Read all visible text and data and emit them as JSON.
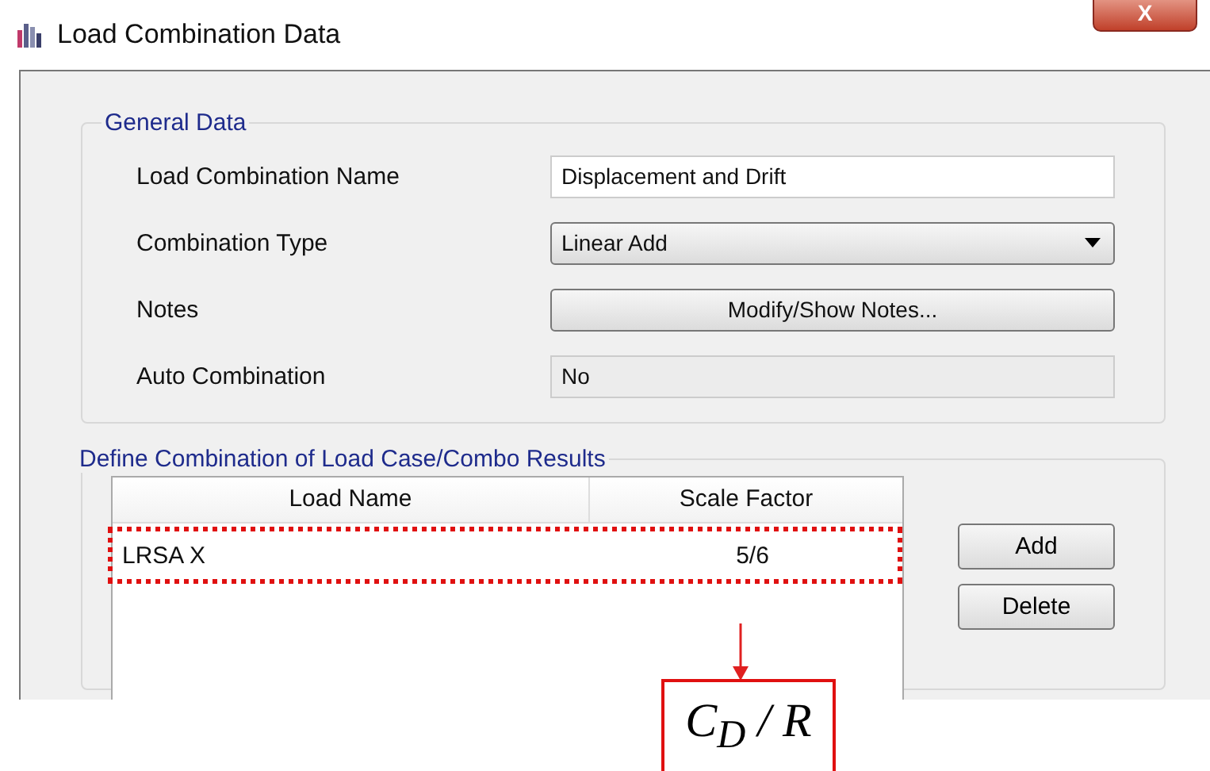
{
  "window": {
    "title": "Load Combination Data",
    "close_label": "X"
  },
  "general_data": {
    "title": "General Data",
    "fields": [
      {
        "label": "Load Combination Name",
        "kind": "text",
        "value": "Displacement and Drift"
      },
      {
        "label": "Combination Type",
        "kind": "dropdown",
        "value": "Linear Add"
      },
      {
        "label": "Notes",
        "kind": "button",
        "value": "Modify/Show Notes..."
      },
      {
        "label": "Auto Combination",
        "kind": "readonly",
        "value": "No"
      }
    ]
  },
  "combination": {
    "title": "Define Combination of Load Case/Combo Results",
    "table": {
      "columns": [
        "Load Name",
        "Scale Factor"
      ],
      "rows": [
        {
          "load_name": "LRSA X",
          "scale_factor": "5/6",
          "highlighted": true
        }
      ]
    },
    "buttons": [
      "Add",
      "Delete"
    ]
  },
  "annotation": {
    "text": "C$_{D}$ / R"
  }
}
